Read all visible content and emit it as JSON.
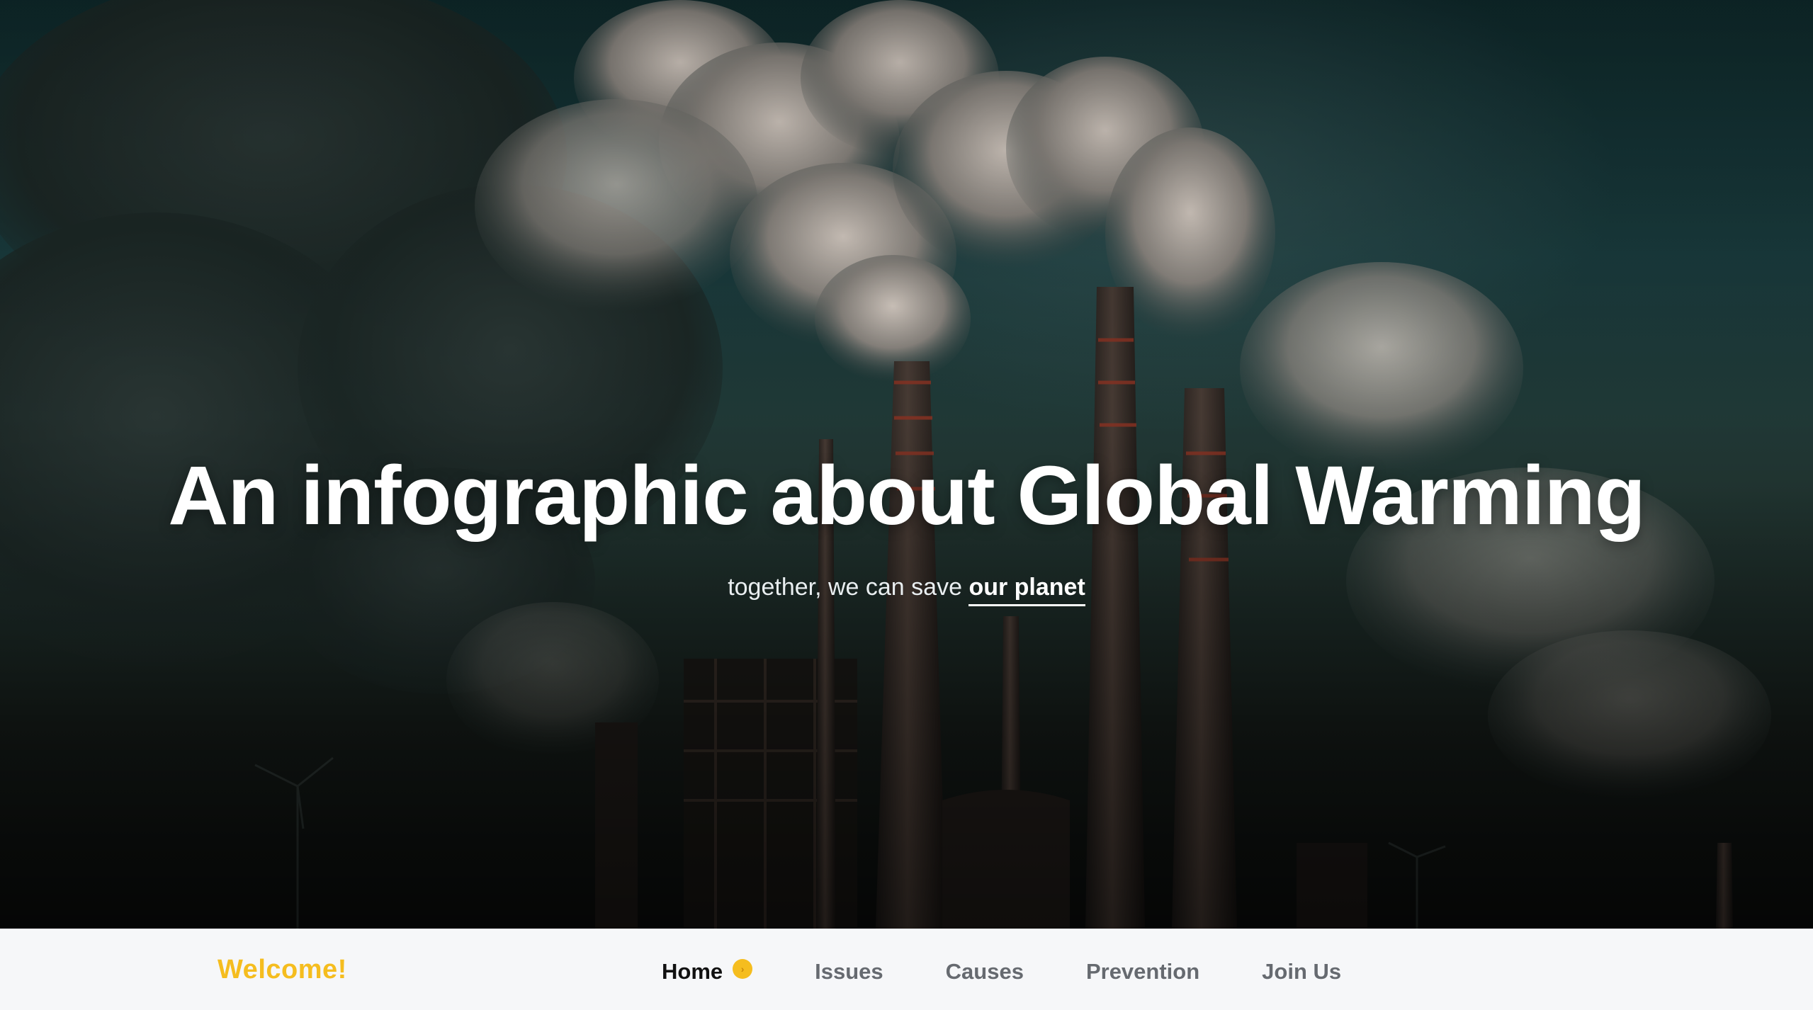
{
  "hero": {
    "title": "An infographic about Global Warming",
    "subtitle_prefix": "together, we can save",
    "subtitle_emphasis": "our planet",
    "background_image": "industrial-smokestacks-photo"
  },
  "navbar": {
    "brand": "Welcome!",
    "items": [
      {
        "label": "Home",
        "active": true
      },
      {
        "label": "Issues",
        "active": false
      },
      {
        "label": "Causes",
        "active": false
      },
      {
        "label": "Prevention",
        "active": false
      },
      {
        "label": "Join Us",
        "active": false
      }
    ],
    "active_indicator_glyph": "›"
  },
  "colors": {
    "accent": "#f5bd1f",
    "nav_text": "#666a70",
    "nav_active": "#111111",
    "navbar_bg": "#f6f7f9",
    "hero_title": "#ffffff"
  }
}
